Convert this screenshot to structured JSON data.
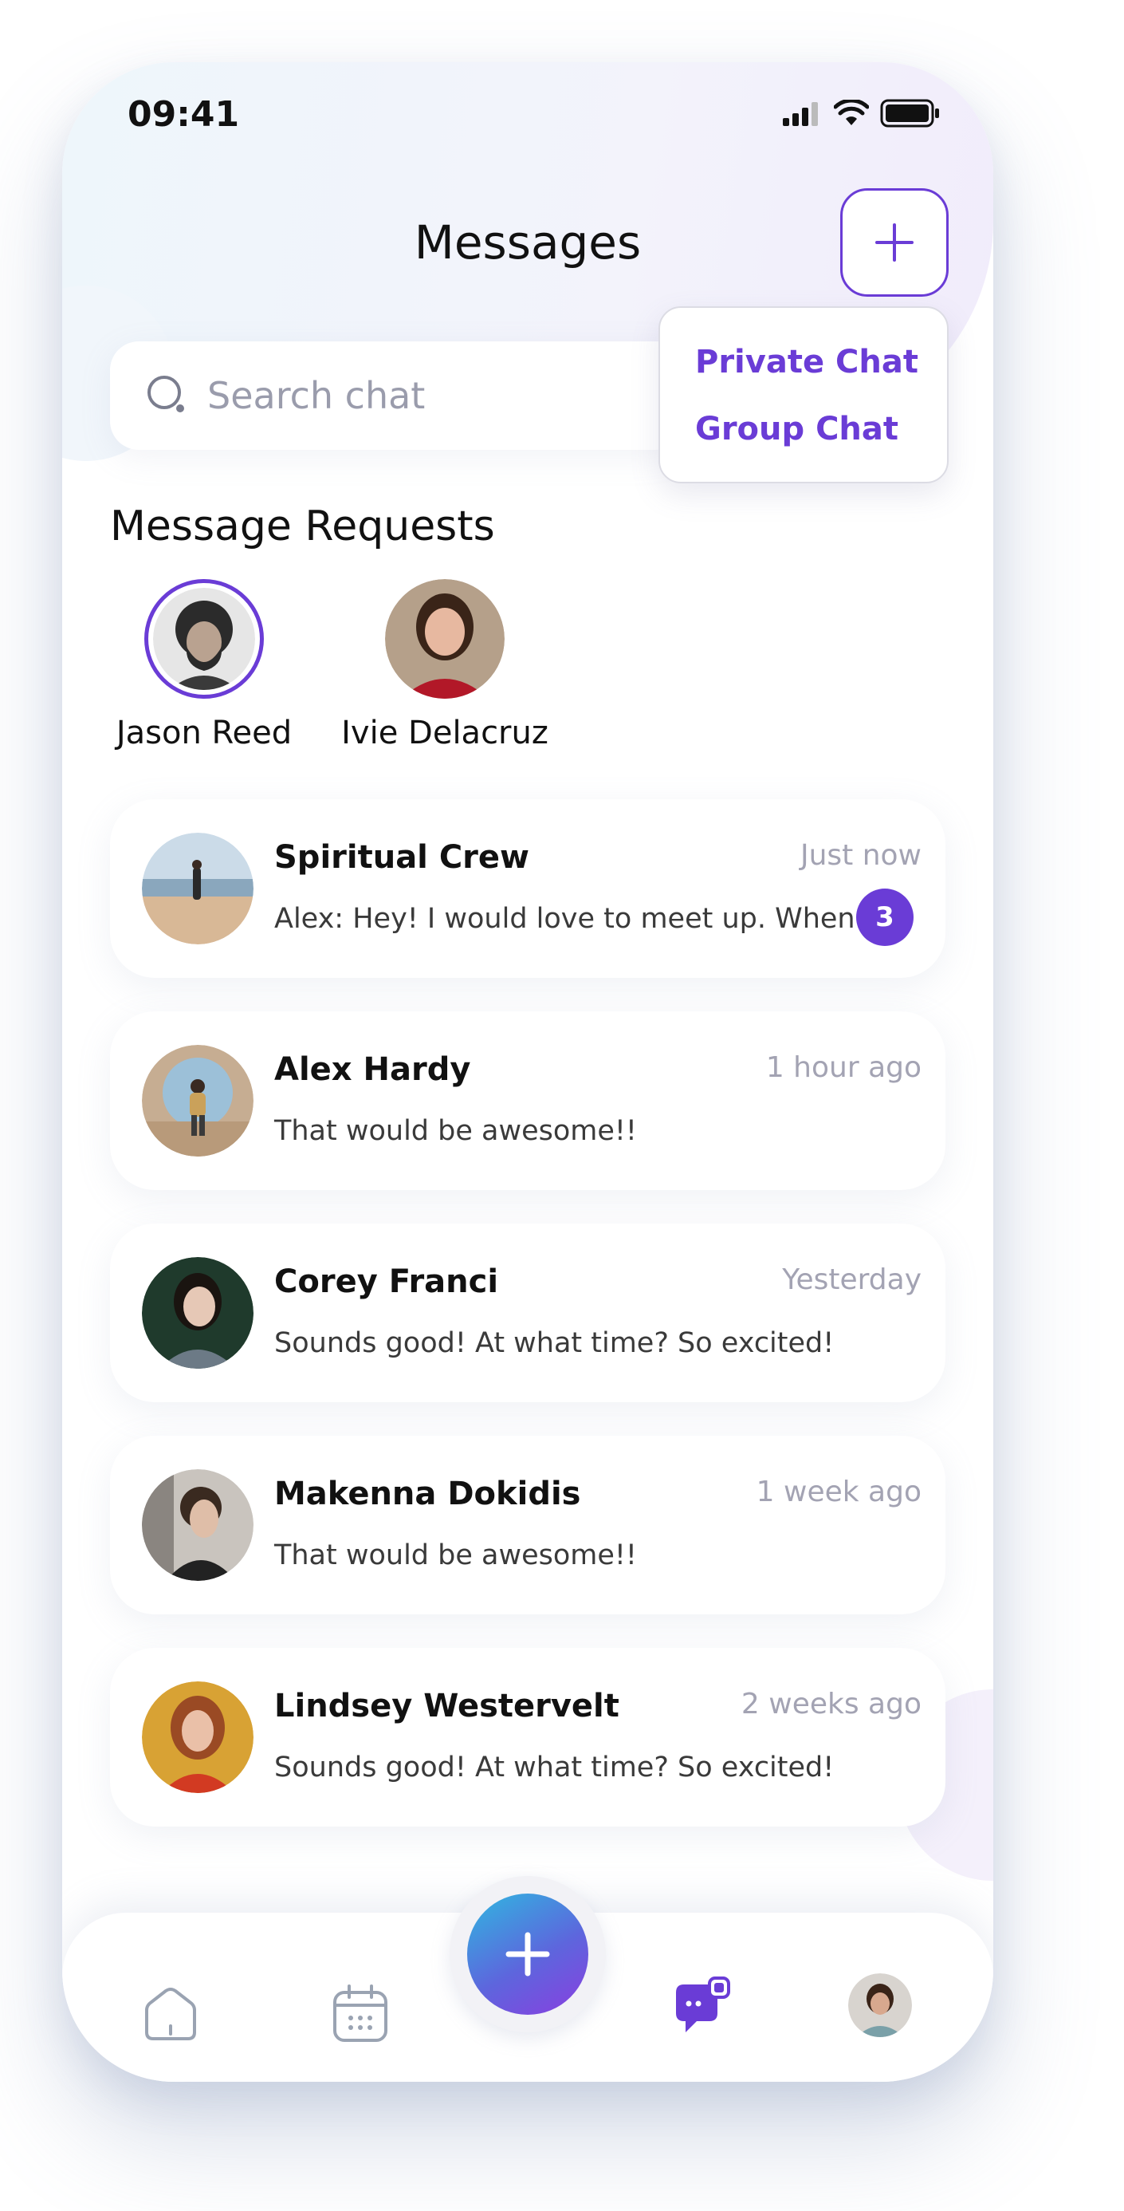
{
  "status_bar": {
    "time": "09:41",
    "signal_icon": "signal-icon",
    "wifi_icon": "wifi-icon",
    "battery_icon": "battery-icon"
  },
  "header": {
    "title": "Messages",
    "new_chat_icon": "plus-icon"
  },
  "search": {
    "placeholder": "Search chat",
    "icon": "search-icon"
  },
  "new_chat_menu": {
    "options": [
      "Private Chat",
      "Group Chat"
    ]
  },
  "requests": {
    "heading": "Message Requests",
    "people": [
      {
        "name": "Jason Reed"
      },
      {
        "name": "Ivie Delacruz"
      }
    ]
  },
  "chats": [
    {
      "name": "Spiritual Crew",
      "time": "Just now",
      "message": "Alex: Hey! I would love to meet up. When...",
      "unread": "3"
    },
    {
      "name": "Alex Hardy",
      "time": "1 hour ago",
      "message": "That would be awesome!!"
    },
    {
      "name": "Corey Franci",
      "time": "Yesterday",
      "message": "Sounds good! At what time? So excited!"
    },
    {
      "name": "Makenna Dokidis",
      "time": "1 week ago",
      "message": "That would be awesome!!"
    },
    {
      "name": "Lindsey Westervelt",
      "time": "2 weeks ago",
      "message": "Sounds good! At what time? So excited!"
    }
  ],
  "tab_bar": {
    "items": [
      "home-icon",
      "calendar-icon",
      "add-icon",
      "chat-icon",
      "profile-avatar"
    ],
    "active": "chat-icon"
  },
  "colors": {
    "accent": "#6a3cd6",
    "muted": "#a3a3b3",
    "text": "#111111"
  }
}
